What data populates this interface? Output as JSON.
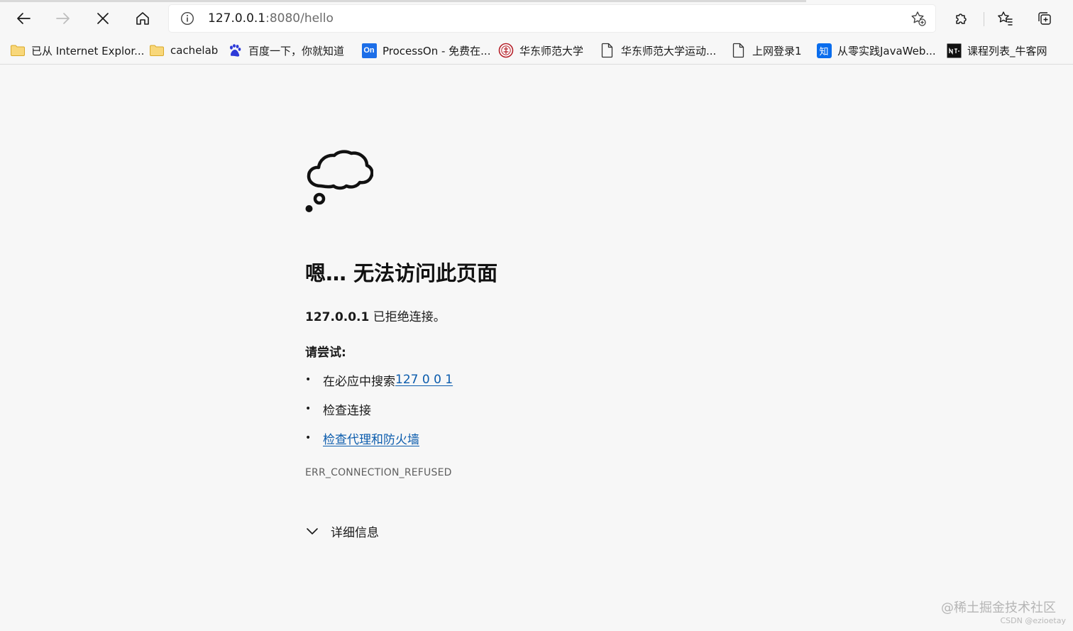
{
  "address_bar": {
    "host": "127.0.0.1",
    "path": ":8080/hello"
  },
  "bookmarks": [
    {
      "label": "已从 Internet Explor...",
      "icon": "folder-icon"
    },
    {
      "label": "cachelab",
      "icon": "folder-icon"
    },
    {
      "label": "百度一下，你就知道",
      "icon": "baidu-icon"
    },
    {
      "label": "ProcessOn - 免费在...",
      "icon": "processon-icon",
      "icon_text": "On"
    },
    {
      "label": "华东师范大学",
      "icon": "ecnu-logo-icon"
    },
    {
      "label": "华东师范大学运动...",
      "icon": "page-icon"
    },
    {
      "label": "上网登录1",
      "icon": "page-icon"
    },
    {
      "label": "从零实践JavaWeb...",
      "icon": "zhihu-icon",
      "icon_text": "知"
    },
    {
      "label": "课程列表_牛客网",
      "icon": "nowcoder-icon"
    }
  ],
  "error_page": {
    "title": "嗯… 无法访问此页面",
    "host": "127.0.0.1",
    "refused_text": " 已拒绝连接。",
    "try_heading": "请尝试:",
    "suggestions": {
      "search_prefix": "在必应中搜索 ",
      "search_link": "127 0 0 1",
      "check_connection": "检查连接",
      "check_proxy": "检查代理和防火墙"
    },
    "error_code": "ERR_CONNECTION_REFUSED",
    "details_label": "详细信息"
  },
  "watermark": {
    "site": "@稀土掘金技术社区",
    "author": "CSDN @ezioetay"
  },
  "colors": {
    "link": "#0b5cad",
    "background": "#f7f7f7"
  }
}
